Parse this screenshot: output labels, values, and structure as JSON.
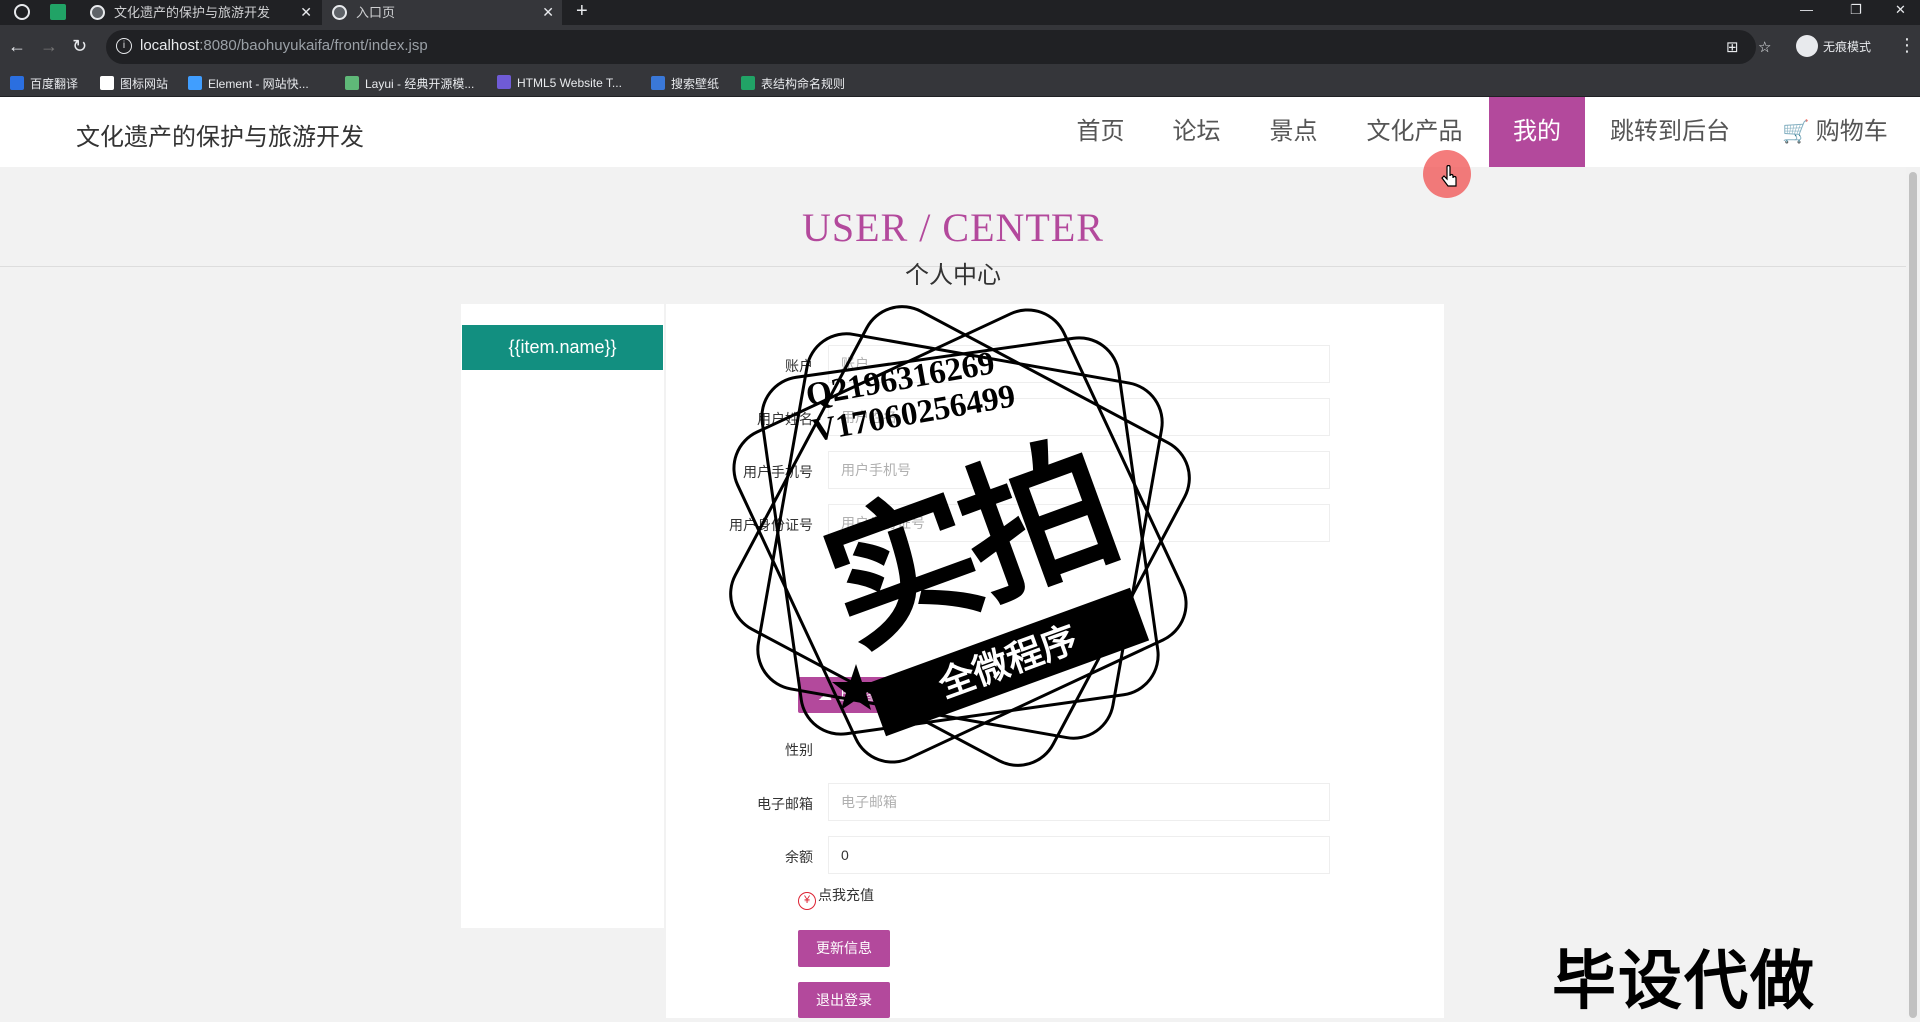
{
  "browser": {
    "tabs": [
      {
        "title": "文化遗产的保护与旅游开发",
        "active": false
      },
      {
        "title": "入口页",
        "active": true
      }
    ],
    "new_tab": "+",
    "window_controls": [
      "—",
      "❐",
      "✕"
    ],
    "url_host": "localhost",
    "url_path": ":8080/baohuyukaifa/front/index.jsp",
    "profile_label": "无痕模式",
    "bookmarks": [
      {
        "label": "百度翻译",
        "color": "#2b6fe0"
      },
      {
        "label": "图标网站",
        "color": "#ffffff"
      },
      {
        "label": "Element - 网站快...",
        "color": "#409eff"
      },
      {
        "label": "Layui - 经典开源模...",
        "color": "#5fb878"
      },
      {
        "label": "HTML5 Website T...",
        "color": "#6f5bd6"
      },
      {
        "label": "搜索壁纸",
        "color": "#3a78d8"
      },
      {
        "label": "表结构命名规则",
        "color": "#21a366"
      }
    ]
  },
  "site": {
    "title": "文化遗产的保护与旅游开发",
    "nav": [
      {
        "label": "首页",
        "active": false
      },
      {
        "label": "论坛",
        "active": false
      },
      {
        "label": "景点",
        "active": false
      },
      {
        "label": "文化产品",
        "active": false
      },
      {
        "label": "我的",
        "active": true
      },
      {
        "label": "跳转到后台",
        "active": false
      },
      {
        "label": "购物车",
        "active": false
      }
    ]
  },
  "page": {
    "title": "USER / CENTER",
    "subtitle": "个人中心"
  },
  "sidebar": {
    "item": "{{item.name}}"
  },
  "form": {
    "account": {
      "label": "账户",
      "placeholder": "账户"
    },
    "name": {
      "label": "用户姓名",
      "placeholder": "用户姓名"
    },
    "phone": {
      "label": "用户手机号",
      "placeholder": "用户手机号"
    },
    "idcard": {
      "label": "用户身份证号",
      "placeholder": "用户身份证号"
    },
    "upload_button": "上传图片",
    "gender": {
      "label": "性别"
    },
    "email": {
      "label": "电子邮箱",
      "placeholder": "电子邮箱"
    },
    "balance": {
      "label": "余额",
      "value": "0"
    },
    "recharge": "点我充值",
    "update_button": "更新信息",
    "logout_button": "退出登录"
  },
  "watermark": {
    "qq": "Q2196316269",
    "vx": "V17060256499",
    "big": "实拍",
    "band": "全微程序",
    "corner": "毕设代做"
  },
  "colors": {
    "accent": "#b3499c",
    "sidebar_active": "#128f80"
  }
}
